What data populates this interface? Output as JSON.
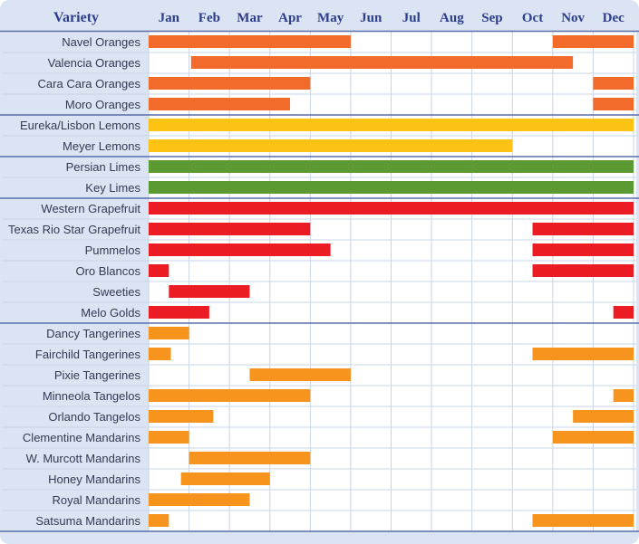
{
  "chart_data": {
    "type": "gantt",
    "header_label": "Variety",
    "months": [
      "Jan",
      "Feb",
      "Mar",
      "Apr",
      "May",
      "Jun",
      "Jul",
      "Aug",
      "Sep",
      "Oct",
      "Nov",
      "Dec"
    ],
    "colors": {
      "oranges": "#f26b2a",
      "lemons": "#fcc314",
      "limes": "#5b9a33",
      "grapefruit": "#ec1c24",
      "mandarins": "#f7941d",
      "frame": "#dbe4f2",
      "row_border": "#c9d4e6",
      "group_divider": "#5b6ca8",
      "text": "#2c3d8c"
    },
    "rows": [
      {
        "name": "Navel Oranges",
        "group": "oranges",
        "segments": [
          [
            0.0,
            5.0
          ],
          [
            10.0,
            12.0
          ]
        ]
      },
      {
        "name": "Valencia Oranges",
        "group": "oranges",
        "segments": [
          [
            1.05,
            10.5
          ]
        ]
      },
      {
        "name": "Cara Cara Oranges",
        "group": "oranges",
        "segments": [
          [
            0.0,
            4.0
          ],
          [
            11.0,
            12.0
          ]
        ]
      },
      {
        "name": "Moro Oranges",
        "group": "oranges",
        "segments": [
          [
            0.0,
            3.5
          ],
          [
            11.0,
            12.0
          ]
        ]
      },
      {
        "name": "Eureka/Lisbon Lemons",
        "group": "lemons",
        "segments": [
          [
            0.0,
            12.0
          ]
        ]
      },
      {
        "name": "Meyer Lemons",
        "group": "lemons",
        "segments": [
          [
            0.0,
            9.0
          ]
        ]
      },
      {
        "name": "Persian Limes",
        "group": "limes",
        "segments": [
          [
            0.0,
            12.0
          ]
        ]
      },
      {
        "name": "Key Limes",
        "group": "limes",
        "segments": [
          [
            0.0,
            12.0
          ]
        ]
      },
      {
        "name": "Western Grapefruit",
        "group": "grapefruit",
        "segments": [
          [
            0.0,
            12.0
          ]
        ]
      },
      {
        "name": "Texas Rio Star Grapefruit",
        "group": "grapefruit",
        "segments": [
          [
            0.0,
            4.0
          ],
          [
            9.5,
            12.0
          ]
        ]
      },
      {
        "name": "Pummelos",
        "group": "grapefruit",
        "segments": [
          [
            0.0,
            4.5
          ],
          [
            9.5,
            12.0
          ]
        ]
      },
      {
        "name": "Oro Blancos",
        "group": "grapefruit",
        "segments": [
          [
            0.0,
            0.5
          ],
          [
            9.5,
            12.0
          ]
        ]
      },
      {
        "name": "Sweeties",
        "group": "grapefruit",
        "segments": [
          [
            0.5,
            2.5
          ]
        ]
      },
      {
        "name": "Melo Golds",
        "group": "grapefruit",
        "segments": [
          [
            0.0,
            1.5
          ],
          [
            11.5,
            12.0
          ]
        ]
      },
      {
        "name": "Dancy Tangerines",
        "group": "mandarins",
        "segments": [
          [
            0.0,
            1.0
          ]
        ]
      },
      {
        "name": "Fairchild Tangerines",
        "group": "mandarins",
        "segments": [
          [
            0.0,
            0.55
          ],
          [
            9.5,
            12.0
          ]
        ]
      },
      {
        "name": "Pixie Tangerines",
        "group": "mandarins",
        "segments": [
          [
            2.5,
            5.0
          ]
        ]
      },
      {
        "name": "Minneola Tangelos",
        "group": "mandarins",
        "segments": [
          [
            0.0,
            4.0
          ],
          [
            11.5,
            12.0
          ]
        ]
      },
      {
        "name": "Orlando Tangelos",
        "group": "mandarins",
        "segments": [
          [
            0.0,
            1.6
          ],
          [
            10.5,
            12.0
          ]
        ]
      },
      {
        "name": "Clementine Mandarins",
        "group": "mandarins",
        "segments": [
          [
            0.0,
            1.0
          ],
          [
            10.0,
            12.0
          ]
        ]
      },
      {
        "name": "W. Murcott Mandarins",
        "group": "mandarins",
        "segments": [
          [
            1.0,
            4.0
          ]
        ]
      },
      {
        "name": "Honey Mandarins",
        "group": "mandarins",
        "segments": [
          [
            0.8,
            3.0
          ]
        ]
      },
      {
        "name": "Royal Mandarins",
        "group": "mandarins",
        "segments": [
          [
            0.0,
            2.5
          ]
        ]
      },
      {
        "name": "Satsuma Mandarins",
        "group": "mandarins",
        "segments": [
          [
            0.0,
            0.5
          ],
          [
            9.5,
            12.0
          ]
        ]
      }
    ]
  }
}
